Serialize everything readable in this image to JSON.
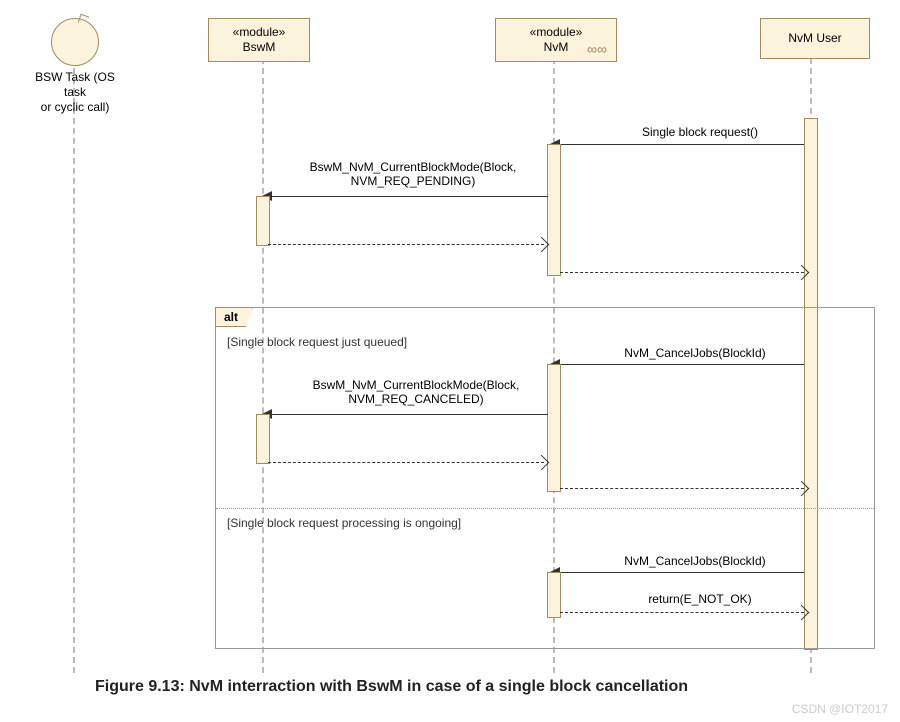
{
  "lifelines": {
    "bsw_task": {
      "label": "BSW Task (OS task\nor cyclic call)"
    },
    "bswm": {
      "stereotype": "«module»",
      "name": "BswM"
    },
    "nvm": {
      "stereotype": "«module»",
      "name": "NvM"
    },
    "user": {
      "name": "NvM User"
    }
  },
  "messages": {
    "single_block_request": "Single block request()",
    "current_block_pending_l1": "BswM_NvM_CurrentBlockMode(Block,",
    "current_block_pending_l2": "NVM_REQ_PENDING)",
    "cancel_jobs_1": "NvM_CancelJobs(BlockId)",
    "current_block_canceled_l1": "BswM_NvM_CurrentBlockMode(Block,",
    "current_block_canceled_l2": "NVM_REQ_CANCELED)",
    "cancel_jobs_2": "NvM_CancelJobs(BlockId)",
    "return_notok": "return(E_NOT_OK)"
  },
  "frame": {
    "tag": "alt",
    "guard_queued": "[Single block request just queued]",
    "guard_processing": "[Single block request processing is ongoing]"
  },
  "caption": "Figure 9.13: NvM interraction with BswM in case of a single block cancellation",
  "watermark": "CSDN @IOT2017"
}
